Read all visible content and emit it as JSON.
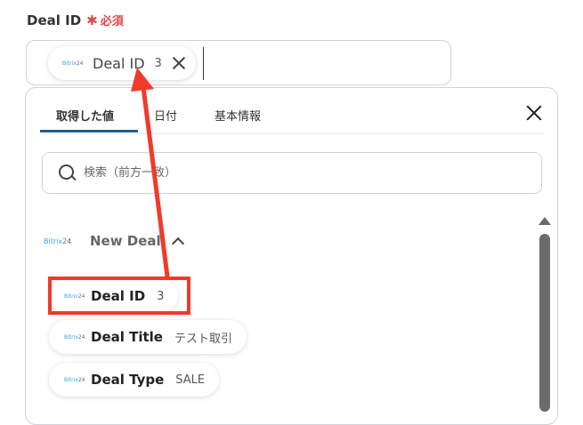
{
  "field": {
    "label": "Deal ID",
    "required_mark": "✱",
    "required_text": "必須"
  },
  "selected_chip": {
    "brand": "Bitrix24",
    "name": "Deal ID",
    "value": "3"
  },
  "tabs": [
    {
      "label": "取得した値",
      "active": true
    },
    {
      "label": "日付",
      "active": false
    },
    {
      "label": "基本情報",
      "active": false
    }
  ],
  "search": {
    "placeholder": "検索（前方一致）"
  },
  "group": {
    "brand": "Bitrix24",
    "title": "New Deal"
  },
  "items": [
    {
      "brand": "Bitrix24",
      "name": "Deal ID",
      "value": "3"
    },
    {
      "brand": "Bitrix24",
      "name": "Deal Title",
      "value": "テスト取引"
    },
    {
      "brand": "Bitrix24",
      "name": "Deal Type",
      "value": "SALE"
    }
  ],
  "colors": {
    "highlight": "#f03a2a",
    "tab_underline": "#1e5d8c",
    "required": "#e04a4a"
  },
  "icons": [
    "close-icon",
    "search-icon",
    "chevron-up-icon",
    "bitrix24-logo"
  ]
}
